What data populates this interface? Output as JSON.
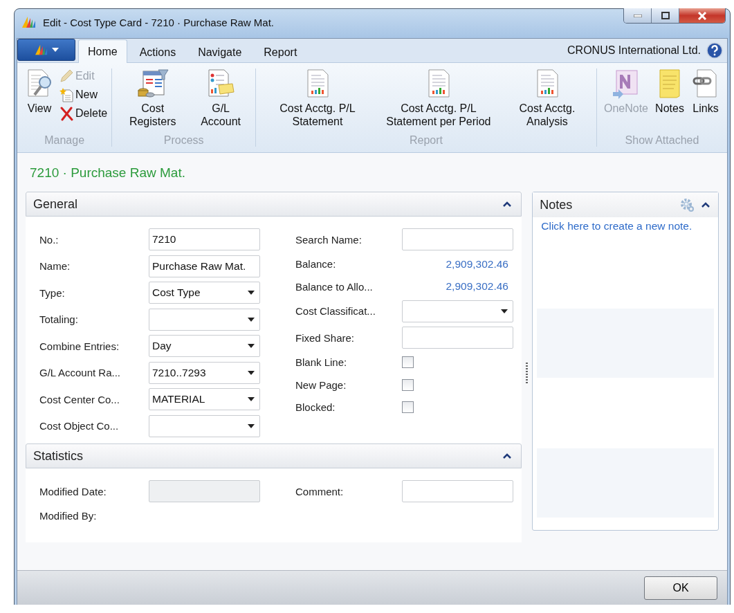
{
  "window": {
    "title": "Edit - Cost Type Card - 7210 · Purchase Raw Mat."
  },
  "tabs": [
    {
      "label": "Home",
      "selected": true
    },
    {
      "label": "Actions",
      "selected": false
    },
    {
      "label": "Navigate",
      "selected": false
    },
    {
      "label": "Report",
      "selected": false
    }
  ],
  "company": "CRONUS International Ltd.",
  "ribbon_groups": [
    {
      "label": "Manage",
      "buttons": [
        {
          "label": "View",
          "kind": "view",
          "disabled": false
        },
        {
          "label": "Edit",
          "kind": "edit",
          "disabled": true
        },
        {
          "label": "New",
          "kind": "new",
          "disabled": false
        },
        {
          "label": "Delete",
          "kind": "delete",
          "disabled": false
        }
      ]
    },
    {
      "label": "Process",
      "buttons": [
        {
          "label": "Cost Registers",
          "kind": "registers",
          "disabled": false
        },
        {
          "label": "G/L Account",
          "kind": "account",
          "disabled": false
        }
      ]
    },
    {
      "label": "Report",
      "buttons": [
        {
          "label": "Cost Acctg. P/L Statement",
          "kind": "report",
          "disabled": false
        },
        {
          "label": "Cost Acctg. P/L Statement per Period",
          "kind": "report",
          "disabled": false
        },
        {
          "label": "Cost Acctg. Analysis",
          "kind": "report",
          "disabled": false
        }
      ]
    },
    {
      "label": "Show Attached",
      "buttons": [
        {
          "label": "OneNote",
          "kind": "onenote",
          "disabled": true
        },
        {
          "label": "Notes",
          "kind": "notes",
          "disabled": false
        },
        {
          "label": "Links",
          "kind": "links",
          "disabled": false
        }
      ]
    }
  ],
  "page_caption": "7210 · Purchase Raw Mat.",
  "sections": [
    {
      "title": "General",
      "expanded": true,
      "left": [
        {
          "label": "No.:",
          "kind": "text",
          "value": "7210"
        },
        {
          "label": "Name:",
          "kind": "text",
          "value": "Purchase Raw Mat."
        },
        {
          "label": "Type:",
          "kind": "dropdown",
          "value": "Cost Type"
        },
        {
          "label": "Totaling:",
          "kind": "dropdown"
        },
        {
          "label": "Combine Entries:",
          "kind": "dropdown",
          "value": "Day"
        },
        {
          "label": "G/L Account Ra...",
          "kind": "dropdown",
          "value": "7210..7293"
        },
        {
          "label": "Cost Center Co...",
          "kind": "dropdown",
          "value": "MATERIAL"
        },
        {
          "label": "Cost Object Co...",
          "kind": "dropdown"
        }
      ],
      "right": [
        {
          "label": "Search Name:",
          "kind": "text"
        },
        {
          "label": "Balance:",
          "kind": "amount",
          "value": "2,909,302.46"
        },
        {
          "label": "Balance to Allo...",
          "kind": "amount",
          "value": "2,909,302.46"
        },
        {
          "label": "Cost Classificat...",
          "kind": "dropdown"
        },
        {
          "label": "Fixed Share:",
          "kind": "text"
        },
        {
          "label": "Blank Line:",
          "kind": "checkbox",
          "checked": false
        },
        {
          "label": "New Page:",
          "kind": "checkbox",
          "checked": false
        },
        {
          "label": "Blocked:",
          "kind": "checkbox",
          "checked": false
        }
      ]
    },
    {
      "title": "Statistics",
      "expanded": true,
      "left": [
        {
          "label": "Modified Date:",
          "kind": "readonly"
        },
        {
          "label": "Modified By:",
          "kind": "label"
        }
      ],
      "right": [
        {
          "label": "Comment:",
          "kind": "text"
        }
      ]
    }
  ],
  "notes_panel": {
    "title": "Notes",
    "expanded": true,
    "link": "Click here to create a new note."
  },
  "buttons": [
    "OK"
  ]
}
